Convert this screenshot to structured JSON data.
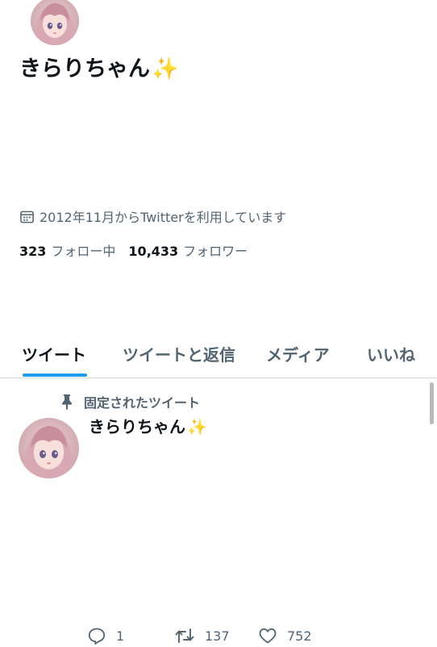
{
  "profile": {
    "display_name": "きらりちゃん",
    "name_emoji": "✨",
    "join_text": "2012年11月からTwitterを利用しています",
    "following_count": "323",
    "following_label": "フォロー中",
    "followers_count": "10,433",
    "followers_label": "フォロワー",
    "avatar_icon": "anime-girl-avatar"
  },
  "tabs": [
    {
      "label": "ツイート",
      "active": true
    },
    {
      "label": "ツイートと返信",
      "active": false
    },
    {
      "label": "メディア",
      "active": false
    },
    {
      "label": "いいね",
      "active": false
    }
  ],
  "pinned_tweet": {
    "pinned_label": "固定されたツイート",
    "author_name": "きらりちゃん",
    "author_emoji": "✨",
    "replies": "1",
    "retweets": "137",
    "likes": "752"
  },
  "colors": {
    "accent": "#1d9bf0",
    "text_primary": "#0f1419",
    "text_secondary": "#536471",
    "divider": "#cfd9de"
  }
}
